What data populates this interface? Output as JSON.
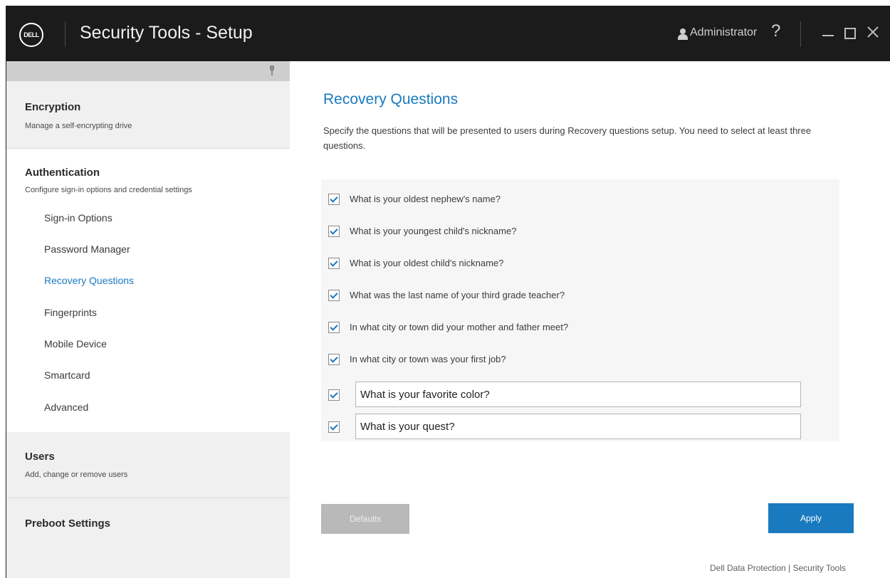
{
  "titlebar": {
    "logo_text": "DELL",
    "title": "Security Tools - Setup",
    "user_name": "Administrator",
    "help_label": "?"
  },
  "sidebar": {
    "sections": [
      {
        "title": "Encryption",
        "subtitle": "Manage a self-encrypting drive"
      },
      {
        "title": "Authentication",
        "subtitle": "Configure sign-in options and credential settings",
        "items": [
          "Sign-in Options",
          "Password Manager",
          "Recovery Questions",
          "Fingerprints",
          "Mobile Device",
          "Smartcard",
          "Advanced"
        ],
        "active_item": "Recovery Questions"
      },
      {
        "title": "Users",
        "subtitle": "Add, change or remove users"
      },
      {
        "title": "Preboot Settings"
      }
    ]
  },
  "main": {
    "title": "Recovery Questions",
    "description": "Specify the questions that will be presented to users during Recovery questions setup. You need to select at least three questions.",
    "questions": [
      {
        "text": "What is your oldest nephew's name?",
        "checked": true,
        "editable": false
      },
      {
        "text": "What is your youngest child's nickname?",
        "checked": true,
        "editable": false
      },
      {
        "text": "What is your oldest child's nickname?",
        "checked": true,
        "editable": false
      },
      {
        "text": "What was the last name of your third grade teacher?",
        "checked": true,
        "editable": false
      },
      {
        "text": "In what city or town did your mother and father meet?",
        "checked": true,
        "editable": false
      },
      {
        "text": "In what city or town was your first job?",
        "checked": true,
        "editable": false
      },
      {
        "text": "What is your favorite color?",
        "checked": true,
        "editable": true
      },
      {
        "text": "What is your quest?",
        "checked": true,
        "editable": true
      }
    ],
    "defaults_label": "Defaults",
    "apply_label": "Apply",
    "footer": "Dell Data Protection | Security Tools"
  },
  "colors": {
    "accent": "#1a7abf",
    "titlebar": "#1b1b1b",
    "sidebar_bg": "#f0f0f0",
    "disabled_button": "#b9b9b9"
  },
  "icons": [
    "dell-logo",
    "user-icon",
    "help-icon",
    "minimize-icon",
    "maximize-icon",
    "close-icon",
    "pin-icon",
    "checkmark-icon"
  ]
}
